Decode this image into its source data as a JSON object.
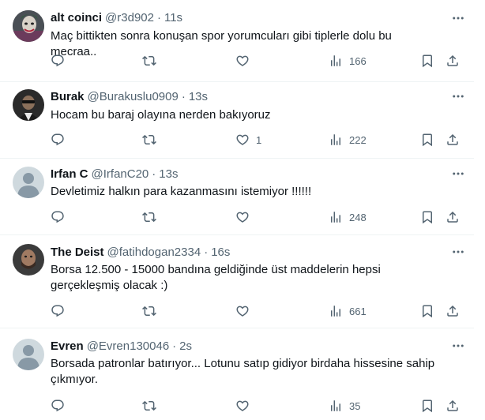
{
  "tweets": [
    {
      "name": "alt coinci",
      "handle": "@r3d902",
      "time": "11s",
      "text": [
        "Maç bittikten sonra konuşan spor yorumcuları gibi tiplerle dolu bu mecraa.."
      ],
      "likes": "",
      "views": "166",
      "avatar": "joker"
    },
    {
      "name": "Burak",
      "handle": "@Burakuslu0909",
      "time": "13s",
      "text": [
        "Hocam bu baraj olayına nerden bakıyoruz"
      ],
      "likes": "1",
      "views": "222",
      "avatar": "photo-dark"
    },
    {
      "name": "Irfan C",
      "handle": "@IrfanC20",
      "time": "13s",
      "text": [
        "Devletimiz halkın para kazanmasını istemiyor !!!!!!"
      ],
      "likes": "",
      "views": "248",
      "avatar": "default"
    },
    {
      "name": "The Deist",
      "handle": "@fatihdogan2334",
      "time": "16s",
      "text": [
        "Borsa 12.500 - 15000 bandına geldiğinde üst maddelerin hepsi",
        "gerçekleşmiş olacak :)"
      ],
      "likes": "",
      "views": "661",
      "avatar": "photo-face"
    },
    {
      "name": "Evren",
      "handle": "@Evren130046",
      "time": "2s",
      "text": [
        "Borsada patronlar batırıyor... Lotunu satıp gidiyor birdaha hissesine sahip",
        "çıkmıyor."
      ],
      "likes": "",
      "views": "35",
      "avatar": "default"
    }
  ],
  "separator": "·",
  "icons": {
    "reply": "reply-icon",
    "retweet": "retweet-icon",
    "like": "heart-icon",
    "views": "views-icon",
    "bookmark": "bookmark-icon",
    "share": "share-icon",
    "more": "more-icon"
  },
  "colors": {
    "secondary": "#536471",
    "text": "#0f1419",
    "border": "#eff3f4",
    "default_avatar": "#b9cad3"
  }
}
